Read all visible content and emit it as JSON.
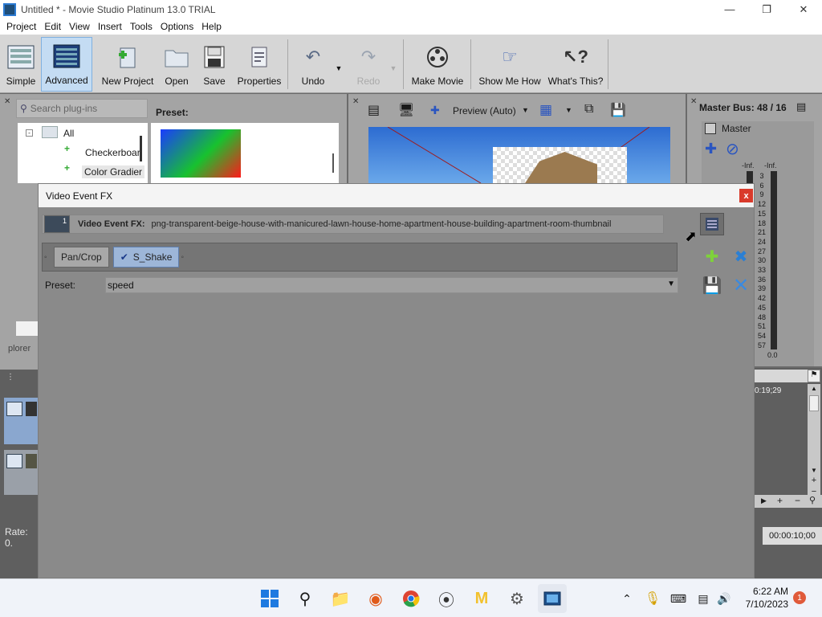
{
  "window": {
    "title": "Untitled * - Movie Studio Platinum 13.0 TRIAL"
  },
  "menu": [
    "Project",
    "Edit",
    "View",
    "Insert",
    "Tools",
    "Options",
    "Help"
  ],
  "toolbar": {
    "simple": "Simple",
    "advanced": "Advanced",
    "new_project": "New Project",
    "open": "Open",
    "save": "Save",
    "properties": "Properties",
    "undo": "Undo",
    "redo": "Redo",
    "make_movie": "Make Movie",
    "show_me_how": "Show Me How",
    "whats_this": "What's This?"
  },
  "plugins": {
    "search_placeholder": "Search plug-ins",
    "tree": [
      "All",
      "Checkerboar",
      "Color Gradier"
    ],
    "preset_label": "Preset:",
    "explorer_tab": "plorer"
  },
  "preview": {
    "mode": "Preview (Auto)"
  },
  "master": {
    "bus_label": "Master Bus: 48 / 16",
    "master_label": "Master",
    "left_inf": "-Inf.",
    "right_inf": "-Inf.",
    "scale": [
      "3",
      "6",
      "9",
      "12",
      "15",
      "18",
      "21",
      "24",
      "27",
      "30",
      "33",
      "36",
      "39",
      "42",
      "45",
      "48",
      "51",
      "54",
      "57"
    ],
    "bottom": "0.0"
  },
  "timeline": {
    "time_1": "0:19;29",
    "time_2": "00:00:10;00",
    "rate": "Rate: 0."
  },
  "dialog": {
    "title": "Video Event FX",
    "close": "x",
    "fx_label": "Video Event FX:",
    "fx_value": "png-transparent-beige-house-with-manicured-lawn-house-home-apartment-house-building-apartment-room-thumbnail",
    "thumb_num": "1",
    "chain": [
      "Pan/Crop",
      "S_Shake"
    ],
    "preset_label": "Preset:",
    "preset_value": "speed"
  },
  "taskbar": {
    "time": "6:22 AM",
    "date": "7/10/2023",
    "notif": "1"
  }
}
